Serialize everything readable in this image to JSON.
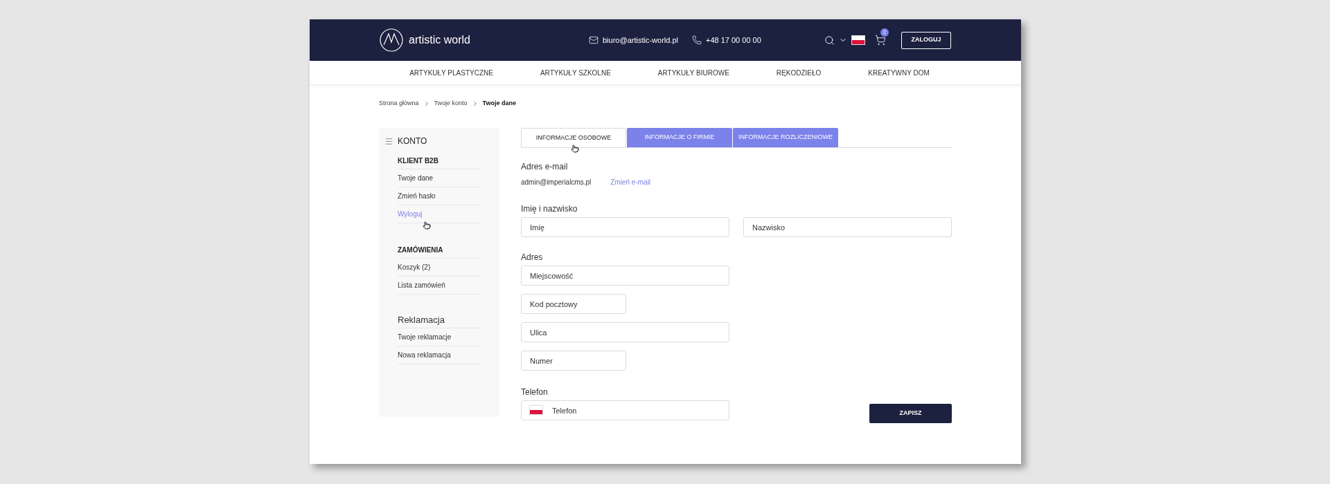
{
  "header": {
    "logo_text": "artistic world",
    "email": "biuro@artistic-world.pl",
    "phone": "+48 17 00 00 00",
    "cart_count": "2",
    "login_button": "ZALOGUJ"
  },
  "nav": [
    "ARTYKUŁY PLASTYCZNE",
    "ARTYKUŁY SZKOLNE",
    "ARTYKUŁY BIUROWE",
    "RĘKODZIEŁO",
    "KREATYWNY DOM"
  ],
  "breadcrumb": [
    {
      "label": "Strona główna",
      "current": false
    },
    {
      "label": "Twoje konto",
      "current": false
    },
    {
      "label": "Twoje dane",
      "current": true
    }
  ],
  "sidebar": {
    "title": "KONTO",
    "sections": [
      {
        "heading": "KLIENT B2B",
        "kind": "caps",
        "items": [
          {
            "label": "Twoje dane",
            "selected": false
          },
          {
            "label": "Zmień hasło",
            "selected": false
          },
          {
            "label": "Wyloguj",
            "selected": true
          }
        ]
      },
      {
        "heading": "ZAMÓWIENIA",
        "kind": "caps",
        "items": [
          {
            "label": "Koszyk (2)",
            "selected": false
          },
          {
            "label": "Lista zamówień",
            "selected": false
          }
        ]
      },
      {
        "heading": "Reklamacja",
        "kind": "plain",
        "items": [
          {
            "label": "Twoje reklamacje",
            "selected": false
          },
          {
            "label": "Nowa reklamacja",
            "selected": false
          }
        ]
      }
    ]
  },
  "tabs": [
    {
      "label": "INFORMACJE OSOBOWE",
      "selected": true
    },
    {
      "label": "INFORMACJE O FIRMIE",
      "selected": false
    },
    {
      "label": "INFORMACJE ROZLICZENIOWE",
      "selected": false
    }
  ],
  "form": {
    "email_label": "Adres e-mail",
    "email_value": "admin@imperialcms.pl",
    "change_email_link": "Zmień e-mail",
    "name_label": "Imię i nazwisko",
    "name_fields": [
      {
        "placeholder": "Imię"
      },
      {
        "placeholder": "Nazwisko"
      }
    ],
    "address_label": "Adres",
    "address_fields": [
      {
        "placeholder": "Miejscowość"
      },
      {
        "placeholder": "Kod pocztowy"
      },
      {
        "placeholder": "Ulica"
      },
      {
        "placeholder": "Numer"
      }
    ],
    "phone_label": "Telefon",
    "phone_field": {
      "placeholder": "Telefon"
    },
    "save_button": "ZAPISZ"
  }
}
